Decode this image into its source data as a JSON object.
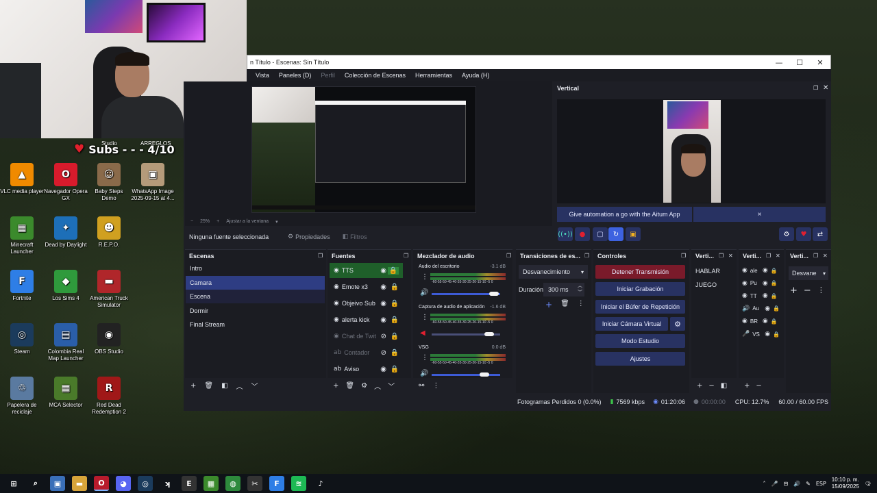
{
  "overlay": {
    "subs_text": "Subs - - - 4/10",
    "studio": "Studio",
    "arreglos": "ARREGLOS"
  },
  "desktop_icons": [
    {
      "label": "VLC media player",
      "icon": "vlc-icon",
      "color": "#f08a00",
      "glyph": "▲"
    },
    {
      "label": "Navegador Opera GX",
      "icon": "opera-gx-icon",
      "color": "#d81b2c",
      "glyph": "O"
    },
    {
      "label": "Baby Steps Demo",
      "icon": "baby-steps-icon",
      "color": "#8a6a4a",
      "glyph": "☺"
    },
    {
      "label": "WhatsApp Image 2025-09-15 at 4...",
      "icon": "image-file-icon",
      "color": "#b59b7a",
      "glyph": "▣"
    },
    {
      "label": "Minecraft Launcher",
      "icon": "minecraft-icon",
      "color": "#3b8a2c",
      "glyph": "▦"
    },
    {
      "label": "Dead by Daylight",
      "icon": "dead-by-daylight-icon",
      "color": "#1d6fb8",
      "glyph": "✦"
    },
    {
      "label": "R.E.P.O.",
      "icon": "repo-icon",
      "color": "#d0a020",
      "glyph": "☻"
    },
    {
      "label": "Fortnite",
      "icon": "fortnite-icon",
      "color": "#2e7ee6",
      "glyph": "F"
    },
    {
      "label": "Los Sims 4",
      "icon": "sims-icon",
      "color": "#2f9a3c",
      "glyph": "◆"
    },
    {
      "label": "American Truck Simulator",
      "icon": "truck-icon",
      "color": "#b0262a",
      "glyph": "▬"
    },
    {
      "label": "Steam",
      "icon": "steam-icon",
      "color": "#1b3b5c",
      "glyph": "◎"
    },
    {
      "label": "Colombia Real Map Launcher",
      "icon": "colombia-map-icon",
      "color": "#2a5ea8",
      "glyph": "▤"
    },
    {
      "label": "OBS Studio",
      "icon": "obs-icon",
      "color": "#222",
      "glyph": "◉"
    },
    {
      "label": "Papelera de reciclaje",
      "icon": "recycle-bin-icon",
      "color": "#5a7aa0",
      "glyph": "♲"
    },
    {
      "label": "MCA Selector",
      "icon": "mca-selector-icon",
      "color": "#4a7a2a",
      "glyph": "▦"
    },
    {
      "label": "Red Dead Redemption 2",
      "icon": "rdr2-icon",
      "color": "#a01818",
      "glyph": "R"
    }
  ],
  "window": {
    "title": "n Título - Escenas: Sin Título",
    "minimize": "—",
    "maximize": "☐",
    "close": "✕"
  },
  "menu": [
    "Vista",
    "Paneles (D)",
    "Perfil",
    "Colección de Escenas",
    "Herramientas",
    "Ayuda (H)"
  ],
  "preview": {
    "zoom": "25%",
    "plus": "+",
    "fit": "Ajustar a la ventana"
  },
  "vertical": {
    "title": "Vertical",
    "aitum_text": "Give automation a go with the Aitum App",
    "aitum_close": "×"
  },
  "props": {
    "no_source": "Ninguna fuente seleccionada",
    "properties": "Propiedades",
    "filters": "Filtros"
  },
  "scenes": {
    "title": "Escenas",
    "items": [
      "Intro",
      "Camara",
      "Escena",
      "Dormir",
      "Final Stream"
    ],
    "selected_index": 1
  },
  "sources": {
    "title": "Fuentes",
    "items": [
      {
        "name": "TTS",
        "visible": true,
        "locked": true,
        "icon": "browser-source-icon"
      },
      {
        "name": "Emote x3",
        "visible": true,
        "locked": false,
        "icon": "browser-source-icon"
      },
      {
        "name": "Objeivo Sub",
        "visible": true,
        "locked": false,
        "icon": "browser-source-icon"
      },
      {
        "name": "alerta kick",
        "visible": true,
        "locked": false,
        "icon": "browser-source-icon"
      },
      {
        "name": "Chat de Twit",
        "visible": false,
        "locked": false,
        "icon": "browser-source-icon"
      },
      {
        "name": "Contador",
        "visible": false,
        "locked": false,
        "icon": "text-source-icon"
      },
      {
        "name": "Aviso",
        "visible": true,
        "locked": false,
        "icon": "text-source-icon"
      }
    ]
  },
  "mixer": {
    "title": "Mezclador de audio",
    "ticks": "-60-55-50-45-40-35-30-25-20-15-10 -5  0",
    "tracks": [
      {
        "name": "Audio del escritorio",
        "db": "-3.1 dB",
        "level": 0.6,
        "muted": false
      },
      {
        "name": "Captura de audio de aplicación",
        "db": "-1.6 dB",
        "level": 0.55,
        "muted": true
      },
      {
        "name": "VSG",
        "db": "0.0 dB",
        "level": 0.5,
        "muted": false
      }
    ]
  },
  "transitions": {
    "title": "Transiciones de es...",
    "selected": "Desvanecimiento",
    "duration_label": "Duración",
    "duration_value": "300 ms"
  },
  "controls": {
    "title": "Controles",
    "stop_stream": "Detener Transmisión",
    "start_recording": "Iniciar Grabación",
    "start_replay": "Iniciar el Búfer de Repetición",
    "start_virtual_cam": "Iniciar Cámara Virtual",
    "studio_mode": "Modo Estudio",
    "settings": "Ajustes"
  },
  "vert_scenes": {
    "title": "Verti...",
    "items": [
      "HABLAR",
      "JUEGO"
    ]
  },
  "vert_sources": {
    "title": "Verti...",
    "items": [
      {
        "name": "ale",
        "icon": "browser-source-icon"
      },
      {
        "name": "Pu",
        "icon": "browser-source-icon"
      },
      {
        "name": "TT",
        "icon": "browser-source-icon"
      },
      {
        "name": "Au",
        "icon": "speaker-icon"
      },
      {
        "name": "BR",
        "icon": "browser-source-icon"
      },
      {
        "name": "VS",
        "icon": "mic-icon"
      }
    ]
  },
  "vert_transitions": {
    "title": "Verti...",
    "selected": "Desvane"
  },
  "status": {
    "dropped": "Fotogramas Perdidos 0 (0.0%)",
    "bitrate": "7569 kbps",
    "stream_time": "01:20:06",
    "rec_time": "00:00:00",
    "cpu": "CPU: 12.7%",
    "fps": "60.00 / 60.00 FPS"
  },
  "taskbar": {
    "items": [
      {
        "icon": "start-windows-icon",
        "glyph": "⊞",
        "color": "transparent"
      },
      {
        "icon": "search-icon",
        "glyph": "⌕",
        "color": "transparent"
      },
      {
        "icon": "store-icon",
        "glyph": "▣",
        "color": "#3a6fb8"
      },
      {
        "icon": "file-explorer-icon",
        "glyph": "▬",
        "color": "#d7a43a"
      },
      {
        "icon": "opera-gx-taskbar-icon",
        "glyph": "O",
        "color": "#b81b2c"
      },
      {
        "icon": "discord-icon",
        "glyph": "◕",
        "color": "#5865f2"
      },
      {
        "icon": "steam-taskbar-icon",
        "glyph": "◎",
        "color": "#1b3b5c"
      },
      {
        "icon": "kick-icon",
        "glyph": "ʞ",
        "color": "transparent"
      },
      {
        "icon": "epic-games-icon",
        "glyph": "E",
        "color": "#333"
      },
      {
        "icon": "minecraft-taskbar-icon",
        "glyph": "▦",
        "color": "#3b8a2c"
      },
      {
        "icon": "chrome-icon",
        "glyph": "◍",
        "color": "#2d8a3c"
      },
      {
        "icon": "capcut-icon",
        "glyph": "✂",
        "color": "#333"
      },
      {
        "icon": "fortnite-taskbar-icon",
        "glyph": "F",
        "color": "#2e7ee6"
      },
      {
        "icon": "spotify-icon",
        "glyph": "≋",
        "color": "#1db954"
      },
      {
        "icon": "tiktok-icon",
        "glyph": "♪",
        "color": "transparent"
      }
    ],
    "lang": "ESP",
    "time": "10:10 p. m.",
    "date": "15/09/2025",
    "notifications": "2"
  }
}
